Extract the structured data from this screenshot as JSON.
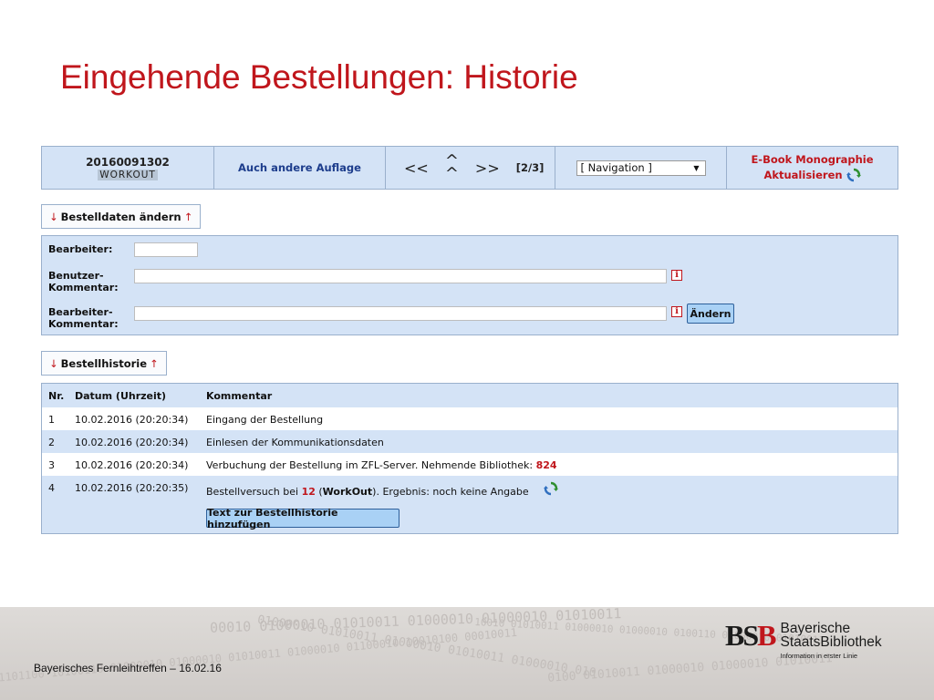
{
  "slide": {
    "title": "Eingehende Bestellungen: Historie"
  },
  "nav": {
    "order_id": "20160091302",
    "workout_tag": "WORKOUT",
    "edition_link": "Auch andere Auflage",
    "prev": "<<",
    "next": ">>",
    "page_indicator": "[2/3]",
    "navigation_select": "[ Navigation ]",
    "media_type": "E-Book Monographie",
    "refresh_label": "Aktualisieren"
  },
  "order_section": {
    "toggle_label": "Bestelldaten ändern",
    "arrow_down": "↓",
    "arrow_up": "↑",
    "bearbeiter_label": "Bearbeiter:",
    "benutzer_label_1": "Benutzer-",
    "benutzer_label_2": "Kommentar:",
    "bearbeiter_komm_label_1": "Bearbeiter-",
    "bearbeiter_komm_label_2": "Kommentar:",
    "info_glyph": "i",
    "submit_label": "Ändern"
  },
  "history_section": {
    "toggle_label": "Bestellhistorie",
    "columns": {
      "nr": "Nr.",
      "datum": "Datum (Uhrzeit)",
      "kommentar": "Kommentar"
    },
    "rows": [
      {
        "nr": "1",
        "datum": "10.02.2016 (20:20:34)",
        "kommentar": "Eingang der Bestellung"
      },
      {
        "nr": "2",
        "datum": "10.02.2016 (20:20:34)",
        "kommentar": "Einlesen der Kommunikationsdaten"
      },
      {
        "nr": "3",
        "datum": "10.02.2016 (20:20:34)",
        "kommentar_pre": "Verbuchung der Bestellung im ZFL-Server. Nehmende Bibliothek: ",
        "kommentar_hl": "824"
      },
      {
        "nr": "4",
        "datum": "10.02.2016 (20:20:35)",
        "kommentar_pre": "Bestellversuch bei ",
        "kommentar_hl": "12",
        "kommentar_mid": " (",
        "kommentar_bold": "WorkOut",
        "kommentar_post": "). Ergebnis: noch keine Angabe"
      }
    ],
    "add_button": "Text zur Bestellhistorie hinzufügen"
  },
  "footer": {
    "text": "Bayerisches Fernleihtreffen – 16.02.16",
    "logo_mark_1": "BS",
    "logo_mark_2": "B",
    "logo_name_1": "Bayerische",
    "logo_name_2": "StaatsBibliothek",
    "logo_tagline": "Information in erster Linie"
  },
  "colors": {
    "title_red": "#c0161c",
    "panel_blue": "#d4e3f6",
    "button_blue": "#a9d1f5"
  },
  "icons": [
    "refresh-icon",
    "info-icon",
    "chevron-down-icon"
  ]
}
